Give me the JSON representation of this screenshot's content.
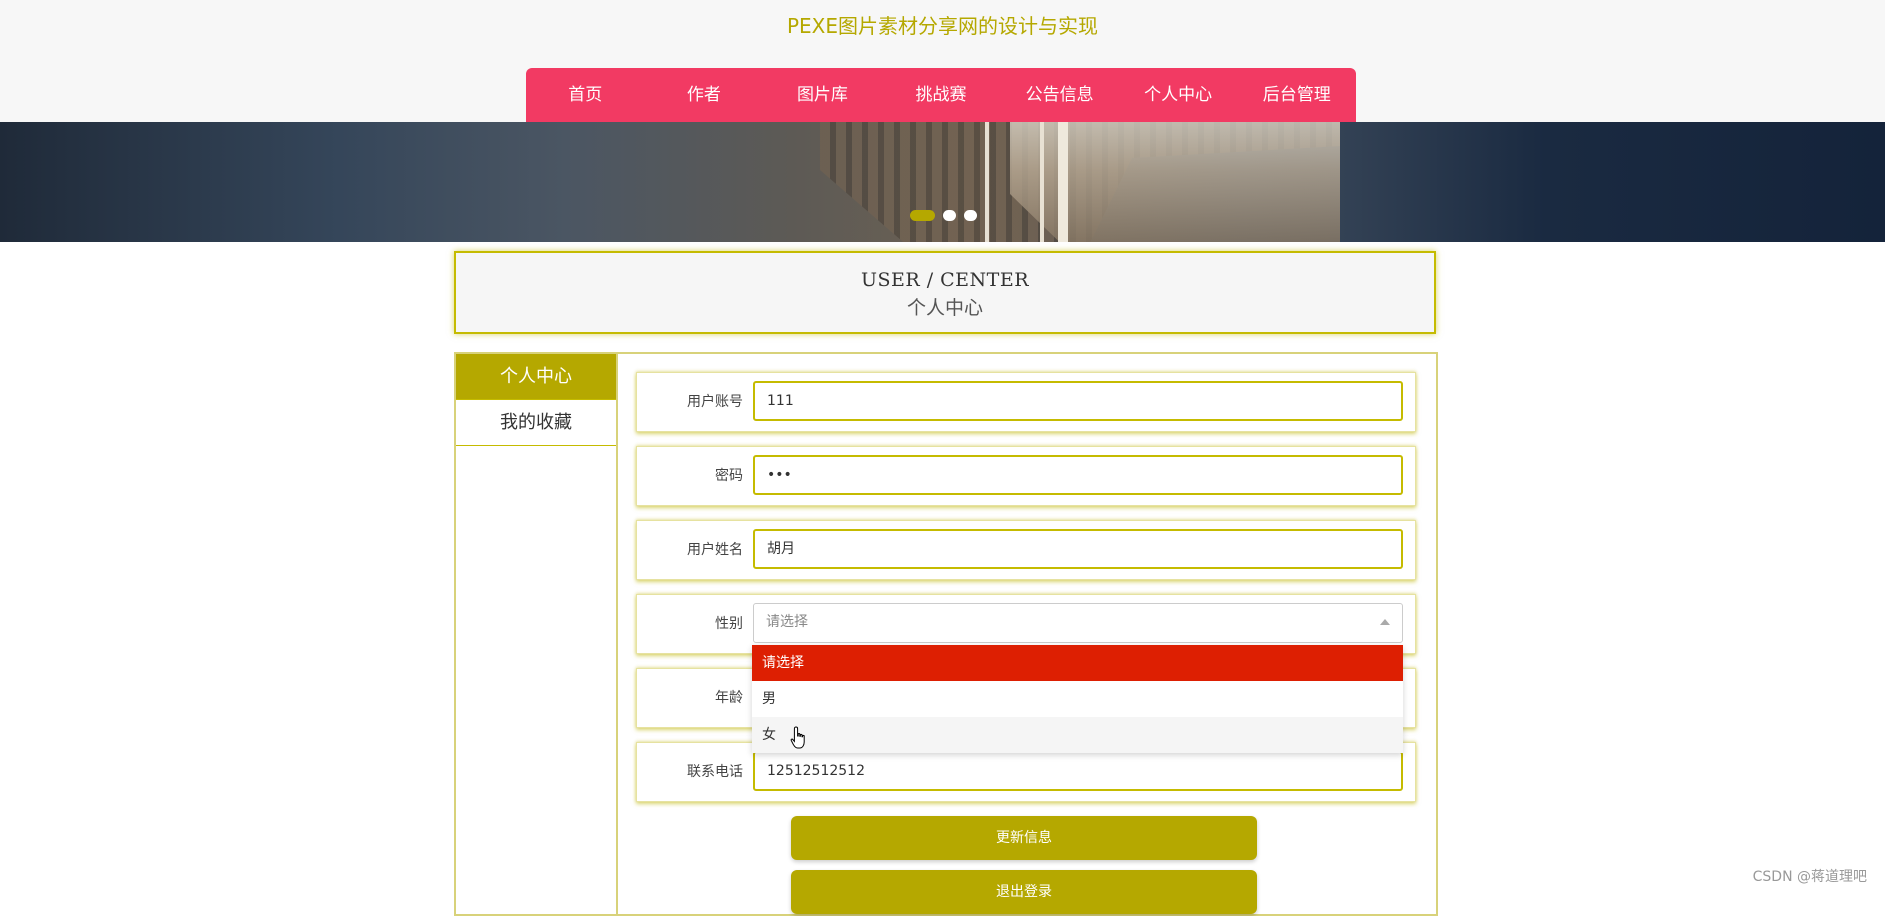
{
  "site": {
    "title": "PEXE图片素材分享网的设计与实现"
  },
  "nav": {
    "items": [
      {
        "label": "首页"
      },
      {
        "label": "作者"
      },
      {
        "label": "图片库"
      },
      {
        "label": "挑战赛"
      },
      {
        "label": "公告信息"
      },
      {
        "label": "个人中心"
      },
      {
        "label": "后台管理"
      }
    ]
  },
  "section": {
    "title_en": "USER / CENTER",
    "title_cn": "个人中心"
  },
  "sidebar": {
    "items": [
      {
        "label": "个人中心",
        "active": true
      },
      {
        "label": "我的收藏",
        "active": false
      }
    ]
  },
  "form": {
    "account": {
      "label": "用户账号",
      "value": "111"
    },
    "password": {
      "label": "密码",
      "value": "•••"
    },
    "name": {
      "label": "用户姓名",
      "value": "胡月"
    },
    "gender": {
      "label": "性别",
      "placeholder": "请选择",
      "options": [
        "请选择",
        "男",
        "女"
      ],
      "highlighted": "请选择"
    },
    "age": {
      "label": "年龄",
      "value": ""
    },
    "phone": {
      "label": "联系电话",
      "value": "12512512512"
    }
  },
  "buttons": {
    "update": "更新信息",
    "logout": "退出登录"
  },
  "watermark": "CSDN @蒋道理吧",
  "colors": {
    "nav": "#f23a63",
    "accent": "#b5a800",
    "option_selected": "#dd1f02"
  }
}
